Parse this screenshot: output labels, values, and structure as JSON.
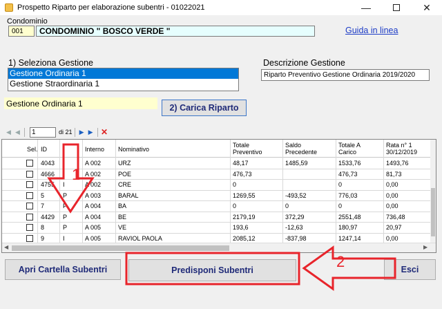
{
  "window": {
    "title": "Prospetto Riparto per elaborazione subentri - 01022021",
    "controls": [
      "minimize-icon",
      "maximize-icon",
      "close-icon"
    ]
  },
  "condominio": {
    "label": "Condominio",
    "code": "001",
    "name": "CONDOMINIO \" BOSCO VERDE \""
  },
  "help_link": "Guida in linea",
  "gestione": {
    "label": "1) Seleziona Gestione",
    "options": [
      "Gestione Ordinaria 1",
      "Gestione Straordinaria 1"
    ],
    "selected_index": 0,
    "current": "Gestione Ordinaria 1",
    "load_button": "2) Carica Riparto"
  },
  "descrizione": {
    "label": "Descrizione Gestione",
    "value": "Riparto Preventivo Gestione Ordinaria 2019/2020"
  },
  "navigator": {
    "position": "1",
    "total": "di 21",
    "icons": [
      "first-icon",
      "prev-icon",
      "next-icon",
      "last-icon",
      "delete-icon"
    ]
  },
  "grid": {
    "columns": [
      "Sel.",
      "ID",
      "",
      "Interno",
      "Nominativo",
      "Totale\nPreventivo",
      "Saldo\nPrecedente",
      "Totale A\nCarico",
      "Rata n° 1\n30/12/2019"
    ],
    "rows": [
      {
        "id": "4043",
        "t": "I",
        "interno": "A 002",
        "nome": "URZ",
        "prev": "48,17",
        "saldo": "1485,59",
        "carico": "1533,76",
        "rata": "1493,76"
      },
      {
        "id": "4666",
        "t": "I",
        "interno": "A 002",
        "nome": "POE",
        "prev": "476,73",
        "saldo": "",
        "carico": "476,73",
        "rata": "81,73"
      },
      {
        "id": "4755",
        "t": "I",
        "interno": "A 002",
        "nome": "CRE",
        "prev": "0",
        "saldo": "",
        "carico": "0",
        "rata": "0,00"
      },
      {
        "id": "5",
        "t": "P",
        "interno": "A 003",
        "nome": "BARAL",
        "prev": "1269,55",
        "saldo": "-493,52",
        "carico": "776,03",
        "rata": "0,00"
      },
      {
        "id": "7",
        "t": "P",
        "interno": "A 004",
        "nome": "BA",
        "prev": "0",
        "saldo": "0",
        "carico": "0",
        "rata": "0,00"
      },
      {
        "id": "4429",
        "t": "P",
        "interno": "A 004",
        "nome": "BE",
        "prev": "2179,19",
        "saldo": "372,29",
        "carico": "2551,48",
        "rata": "736,48"
      },
      {
        "id": "8",
        "t": "P",
        "interno": "A 005",
        "nome": "VE",
        "prev": "193,6",
        "saldo": "-12,63",
        "carico": "180,97",
        "rata": "20,97"
      },
      {
        "id": "9",
        "t": "I",
        "interno": "A 005",
        "nome": "RAVIOL PAOLA",
        "prev": "2085,12",
        "saldo": "-837,98",
        "carico": "1247,14",
        "rata": "0,00"
      }
    ]
  },
  "buttons": {
    "apri": "Apri Cartella Subentri",
    "predisponi": "Predisponi Subentri",
    "esci": "Esci"
  },
  "annotations": {
    "arrow1_number": "1",
    "arrow2_number": "2",
    "color": "#e8242b"
  }
}
